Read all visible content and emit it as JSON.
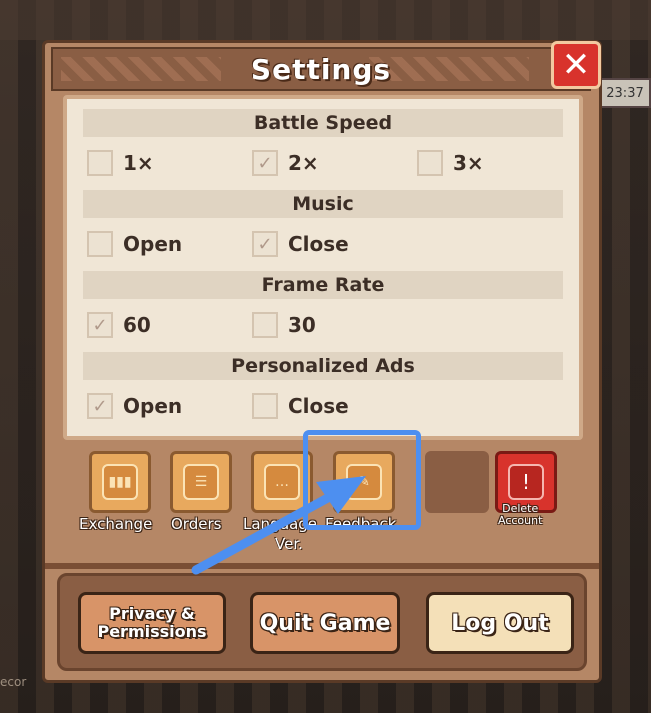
{
  "window": {
    "title": "Settings"
  },
  "background": {
    "clock_text": "23:37",
    "corner_label": "ecor"
  },
  "sections": [
    {
      "heading": "Battle Speed",
      "options": [
        {
          "label": "1×",
          "checked": false
        },
        {
          "label": "2×",
          "checked": true
        },
        {
          "label": "3×",
          "checked": false
        }
      ]
    },
    {
      "heading": "Music",
      "options": [
        {
          "label": "Open",
          "checked": false
        },
        {
          "label": "Close",
          "checked": true
        }
      ]
    },
    {
      "heading": "Frame Rate",
      "options": [
        {
          "label": "60",
          "checked": true
        },
        {
          "label": "30",
          "checked": false
        }
      ]
    },
    {
      "heading": "Personalized Ads",
      "options": [
        {
          "label": "Open",
          "checked": true
        },
        {
          "label": "Close",
          "checked": false
        }
      ]
    }
  ],
  "icon_buttons": {
    "exchange": "Exchange",
    "orders": "Orders",
    "language": "Language",
    "feedback": "Feedback",
    "delete_account_line1": "Delete",
    "delete_account_line2": "Account"
  },
  "version_label": "Ver.",
  "bottom_buttons": {
    "privacy_line1": "Privacy &",
    "privacy_line2": "Permissions",
    "quit": "Quit Game",
    "logout": "Log Out"
  },
  "check_mark": "✓",
  "close_glyph": "✕",
  "colors": {
    "highlight": "#4d8ff0",
    "delete_red": "#d8332c"
  }
}
